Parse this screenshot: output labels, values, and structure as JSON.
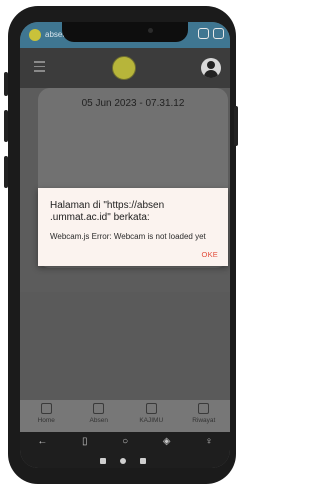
{
  "statusbar": {
    "url_text": "absen.ummat.ac.id/absen"
  },
  "card": {
    "date_time": "05 Jun 2023 - 07.31.12"
  },
  "dialog": {
    "title": "Halaman di \"https://absen .ummat.ac.id\" berkata:",
    "message": "Webcam.js Error: Webcam is not loaded yet",
    "ok_label": "OKE"
  },
  "bottom_nav": {
    "items": [
      {
        "label": "Home",
        "icon": "home-icon"
      },
      {
        "label": "Absen",
        "icon": "camera-icon"
      },
      {
        "label": "KAJIMU",
        "icon": "camera-icon"
      },
      {
        "label": "Riwayat",
        "icon": "document-icon"
      }
    ]
  },
  "system_nav": {
    "icons": [
      "back-icon",
      "book-icon",
      "home-circle-icon",
      "gamepad-icon",
      "profile-icon"
    ]
  },
  "colors": {
    "statusbar": "#3f7691",
    "dialog_bg": "#fbf3ef",
    "accent": "#e24d3b"
  }
}
